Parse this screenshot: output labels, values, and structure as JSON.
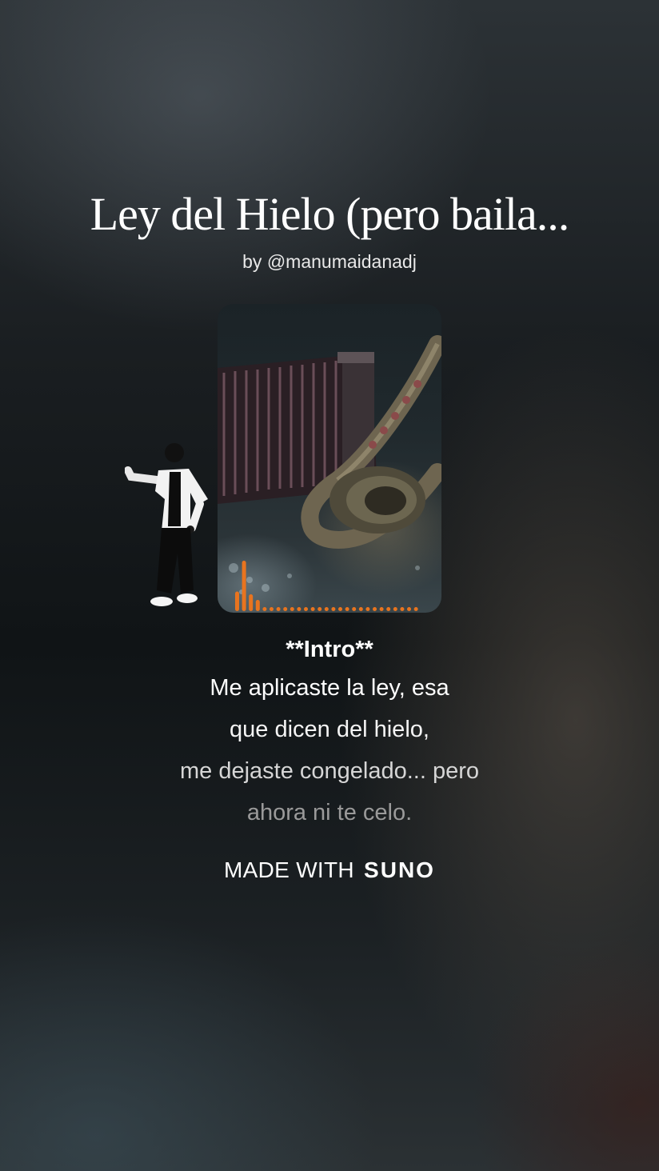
{
  "song": {
    "title": "Ley del Hielo (pero baila...",
    "byline": "by @manumaidanadj"
  },
  "lyrics": {
    "heading": "**Intro**",
    "lines": [
      "Me aplicaste la ley, esa",
      "que dicen del hielo,",
      "me dejaste congelado... pero",
      "ahora ni te celo."
    ]
  },
  "footer": {
    "made_with": "MADE WITH",
    "brand": "SUNO"
  },
  "colors": {
    "visualizer": "#e8741f",
    "text": "#ffffff"
  },
  "icons": {
    "cover": "accordion-saxophone-artwork",
    "dancer": "dancing-figure-icon"
  },
  "visualizer_levels": [
    0.35,
    0.9,
    0.3,
    0.2,
    0.05,
    0.05,
    0.04,
    0.04,
    0.04,
    0.04,
    0.04,
    0.04,
    0.04,
    0.04,
    0.04,
    0.04,
    0.04,
    0.04,
    0.04,
    0.04,
    0.04,
    0.05,
    0.06,
    0.05,
    0.04,
    0.04,
    0.04
  ]
}
